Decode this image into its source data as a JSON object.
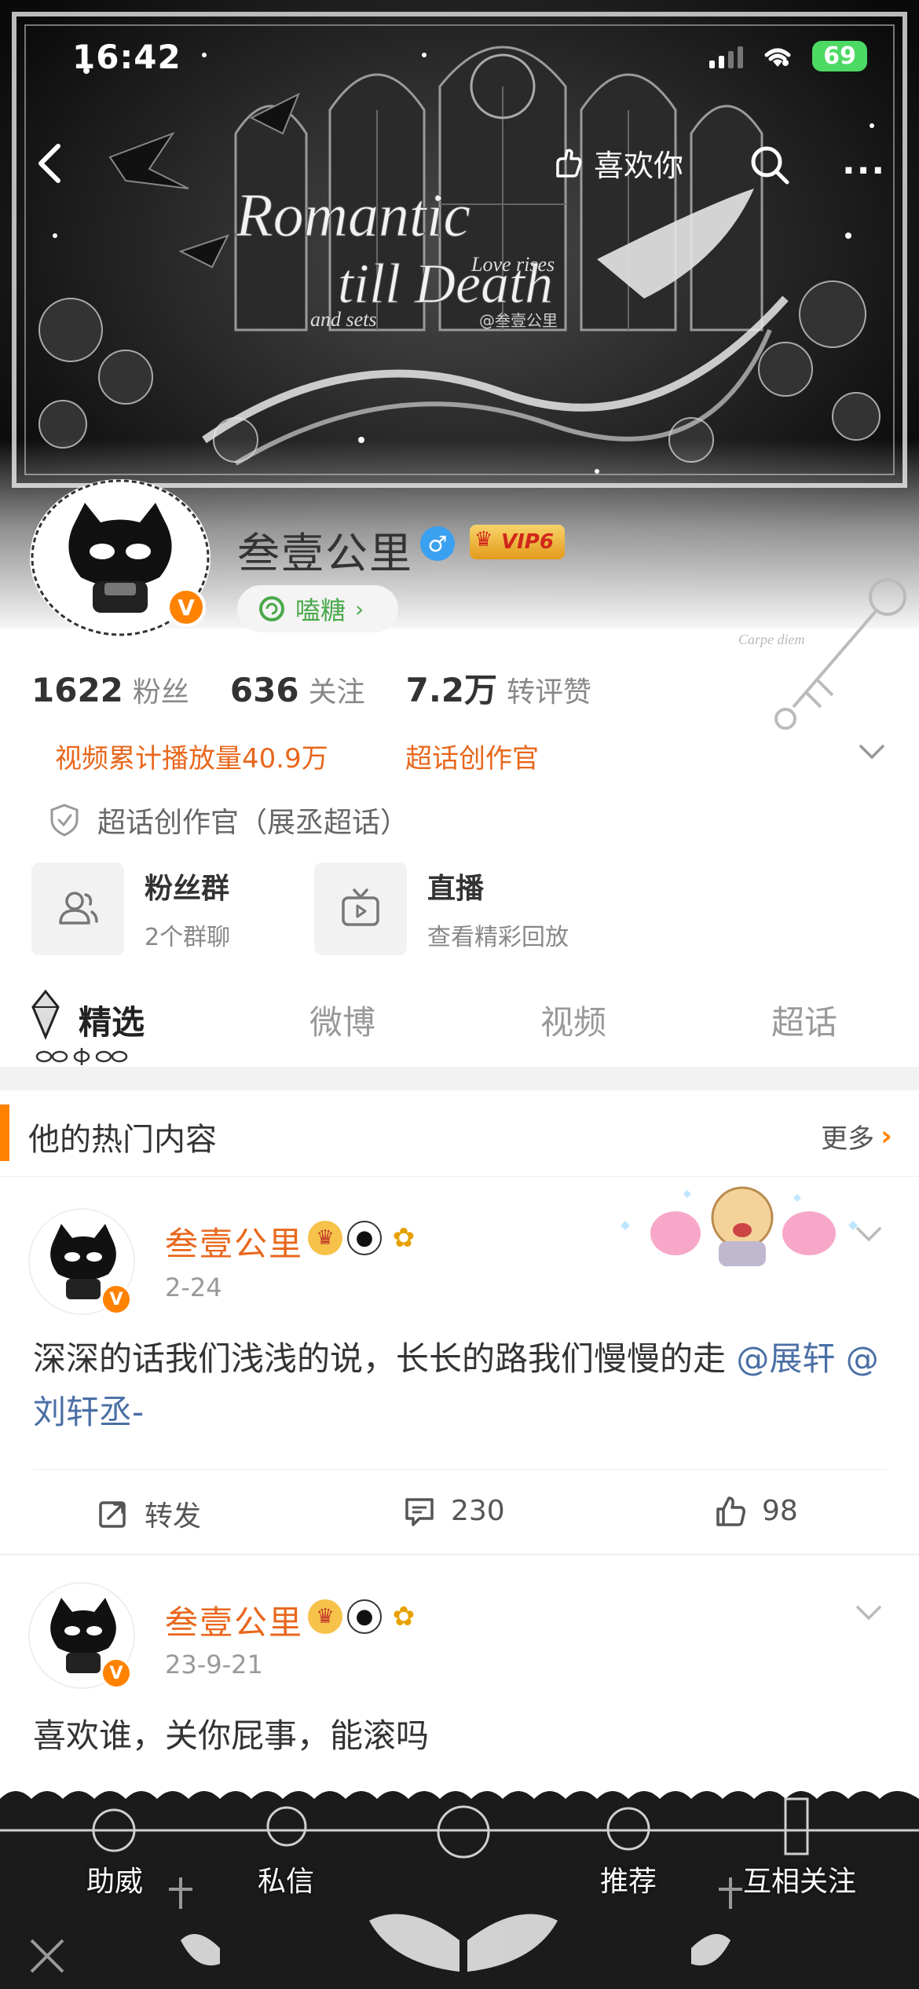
{
  "status_bar": {
    "time": "16:42",
    "battery": "69"
  },
  "nav": {
    "like_label": "喜欢你"
  },
  "banner": {
    "title_line1": "Romantic",
    "title_line2": "till Death",
    "title_small": "Love rises",
    "title_small2": "and sets",
    "watermark": "@叁壹公里"
  },
  "profile": {
    "name": "叁壹公里",
    "vip_label": "VIP6",
    "tang_label": "嗑糖",
    "verified_mark": "V",
    "stats": [
      {
        "value": "1622",
        "label": "粉丝"
      },
      {
        "value": "636",
        "label": "关注"
      },
      {
        "value": "7.2万",
        "label": "转评赞"
      }
    ],
    "tags": [
      "视频累计播放量40.9万",
      "超话创作官"
    ],
    "supertopic_line": "超话创作官（展丞超话）",
    "key_art_text": "Carpe diem"
  },
  "cards": [
    {
      "title": "粉丝群",
      "sub": "2个群聊",
      "icon": "group-icon"
    },
    {
      "title": "直播",
      "sub": "查看精彩回放",
      "icon": "tv-icon"
    }
  ],
  "tabs": [
    "精选",
    "微博",
    "视频",
    "超话"
  ],
  "hot": {
    "title": "他的热门内容",
    "more": "更多"
  },
  "posts": [
    {
      "name": "叁壹公里",
      "date": "2-24",
      "text_plain": "深深的话我们浅浅的说，长长的路我们慢慢的走",
      "mention1": "@展轩",
      "mention2": "@刘轩丞-",
      "repost_label": "转发",
      "comments": "230",
      "likes": "98"
    },
    {
      "name": "叁壹公里",
      "date": "23-9-21",
      "text_plain": "喜欢谁，关你屁事，能滚吗"
    }
  ],
  "bottom_bar": [
    "助威",
    "私信",
    "推荐",
    "互相关注"
  ],
  "colors": {
    "accent": "#ff8200",
    "name": "#e8671c",
    "mention": "#4a6fa5",
    "tang": "#4aa84a"
  }
}
